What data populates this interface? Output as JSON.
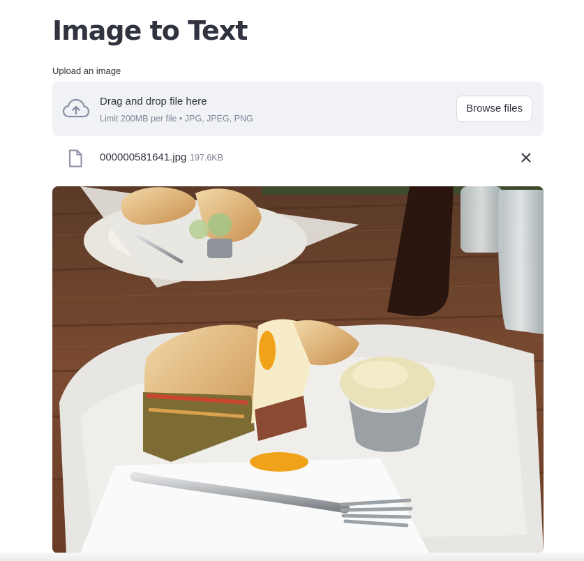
{
  "header": {
    "title": "Image to Text"
  },
  "uploader": {
    "label": "Upload an image",
    "drop_title": "Drag and drop file here",
    "drop_hint": "Limit 200MB per file • JPG, JPEG, PNG",
    "browse_label": "Browse files",
    "icon": "cloud-upload-icon"
  },
  "file": {
    "name": "000000581641.jpg",
    "size": "197.6KB",
    "icon": "file-icon",
    "remove_icon": "close-icon"
  },
  "colors": {
    "text": "#31333f",
    "muted": "#808495",
    "dropzone_bg": "#f0f2f6"
  }
}
